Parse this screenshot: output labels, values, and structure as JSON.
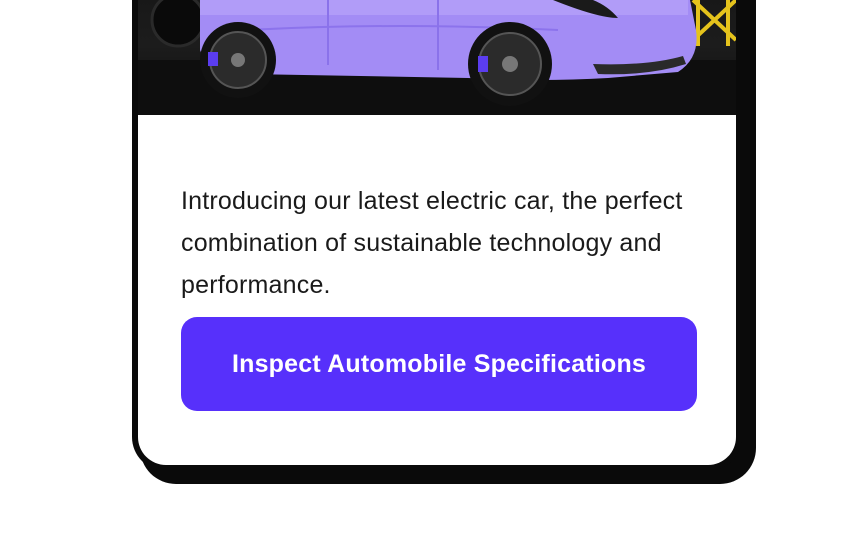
{
  "hero": {
    "image_alt": "Purple electric car parked in a dark garage",
    "car_color": "#a38cf5",
    "accent_color": "#e5c31c"
  },
  "product": {
    "description": "Introducing our latest electric car, the perfect combination of sustainable technology and performance."
  },
  "cta": {
    "label": "Inspect Automobile Specifications",
    "color": "#5730fb"
  }
}
